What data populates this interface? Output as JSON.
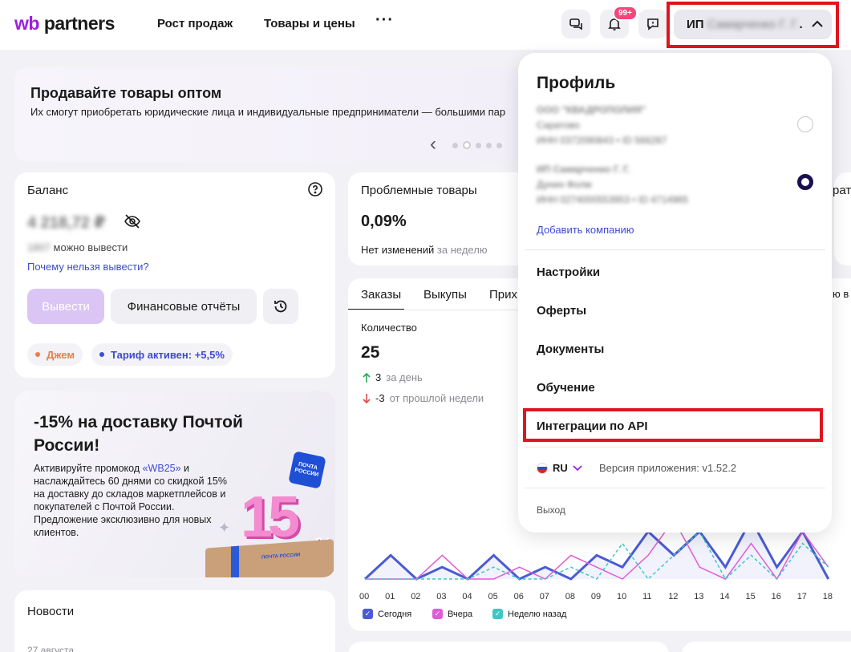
{
  "header": {
    "logo_wb": "wb",
    "logo_partners": "partners",
    "nav": [
      "Рост продаж",
      "Товары и цены"
    ],
    "more": "···",
    "notifications_badge": "99+",
    "profile_prefix": "ИП",
    "profile_name": "Самарченко Г. Г.",
    "profile_suffix": "."
  },
  "banner": {
    "title": "Продавайте товары оптом",
    "text": "Их смогут приобретать юридические лица и индивидуальные предприниматели — большими пар",
    "prev_icon": "‹"
  },
  "balance": {
    "title": "Баланс",
    "amount": "4 218,72 ₽",
    "available_amount": "1807",
    "available_label": "можно вывести",
    "why_link": "Почему нельзя вывести?",
    "withdraw_button": "Вывести",
    "reports_button": "Финансовые отчёты",
    "tags": [
      {
        "label": "Джем",
        "color": "#f07a4a",
        "text_color": "#f07a4a"
      },
      {
        "label": "Тариф активен: +5,5%",
        "color": "#3e4bd0",
        "text_color": "#3e4bd0"
      }
    ]
  },
  "problems": {
    "title": "Проблемные товары",
    "value": "0,09%",
    "change": "Нет изменений",
    "period": "за неделю"
  },
  "orders": {
    "tabs": [
      "Заказы",
      "Выкупы",
      "Прих"
    ],
    "metric_label": "Количество",
    "metric_value": "25",
    "day_delta": "3",
    "day_label": "за день",
    "week_delta": "-3",
    "week_label": "от прошлой недели"
  },
  "promo": {
    "title": "-15% на доставку Почтой России!",
    "text_before": "Активируйте промокод ",
    "code": "«WB25»",
    "text_after": " и наслаждайтесь 60 днями со скидкой 15% на доставку до складов маркетплейсов и покупателей с Почтой России. Предложение эксклюзивно для новых клиентов.",
    "stamp_text": "ПОЧТА РОССИИ",
    "big_number": "15",
    "percent": "%",
    "box_label": "ПОЧТА РОССИИ"
  },
  "news": {
    "title": "Новости",
    "date": "27 августа"
  },
  "dropdown": {
    "title": "Профиль",
    "companies": [
      {
        "name": "ООО \"КВАДРОПОЛИЯ\"",
        "city": "Саратово",
        "ids": "ИНН 0372090843 • ID 566287",
        "selected": false
      },
      {
        "name": "ИП Самарченко Г. Г.",
        "city": "Дунин Фолм",
        "ids": "ИНН 0274000553953 • ID 4714965",
        "selected": true
      }
    ],
    "add_company": "Добавить компанию",
    "menu": [
      "Настройки",
      "Оферты",
      "Документы",
      "Обучение",
      "Интеграции по API"
    ],
    "lang": "RU",
    "version": "Версия приложения: v1.52.2",
    "logout": "Выход"
  },
  "right_edge": {
    "text1": "рат",
    "text2": "ю в"
  },
  "chart_data": {
    "type": "line",
    "x": [
      "00",
      "01",
      "02",
      "03",
      "04",
      "05",
      "06",
      "07",
      "08",
      "09",
      "10",
      "11",
      "12",
      "13",
      "14",
      "15",
      "16",
      "17",
      "18"
    ],
    "series": [
      {
        "name": "Сегодня",
        "color": "#4a5bd4",
        "values": [
          0,
          2,
          0,
          1,
          0,
          2,
          0,
          1,
          0,
          2,
          1,
          4,
          2,
          4,
          1,
          5,
          1,
          4,
          0
        ]
      },
      {
        "name": "Вчера",
        "color": "#e35ad6",
        "values": [
          0,
          0,
          0,
          2,
          0,
          0,
          1,
          0,
          2,
          1,
          0,
          2,
          5,
          1,
          0,
          3,
          0,
          4,
          1
        ]
      },
      {
        "name": "Неделю назад",
        "color": "#3fc6c4",
        "values": [
          0,
          0,
          0,
          0,
          0,
          1,
          0,
          0,
          1,
          0,
          3,
          0,
          2,
          4,
          0,
          2,
          0,
          3,
          1
        ]
      }
    ],
    "ylim": [
      0,
      5
    ]
  }
}
